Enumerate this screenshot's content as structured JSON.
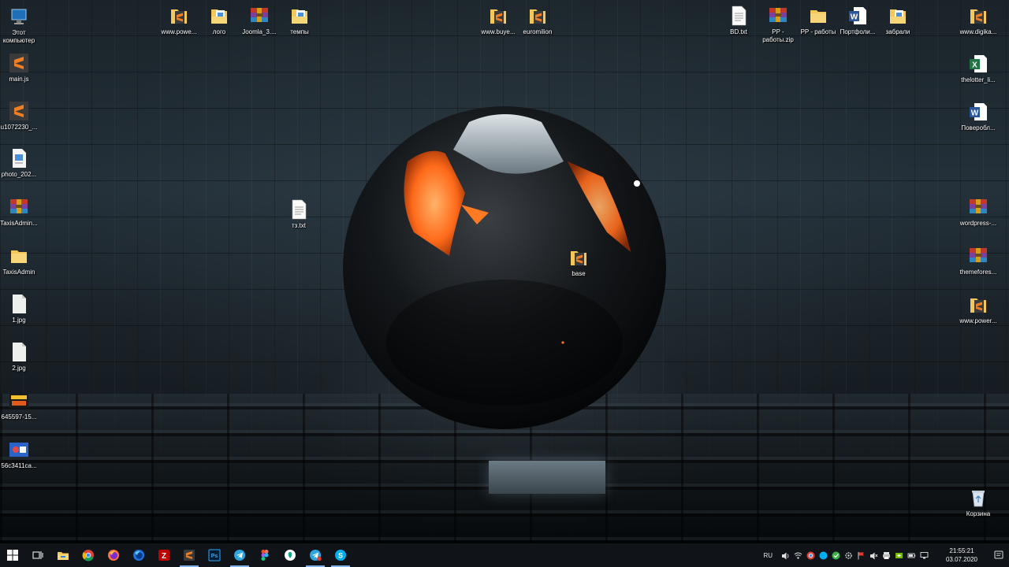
{
  "desktop_icons": [
    {
      "label": "Этот\nкомпьютер",
      "icon": "this-pc-icon",
      "kind": "pc"
    },
    {
      "label": "main.js",
      "icon": "sublime-text-icon",
      "kind": "sublime"
    },
    {
      "label": "u1072230_...",
      "icon": "sublime-text-icon",
      "kind": "sublime"
    },
    {
      "label": "photo_202...",
      "icon": "image-file-icon",
      "kind": "doc"
    },
    {
      "label": "TaxisAdmin...",
      "icon": "winrar-archive-icon",
      "kind": "rar"
    },
    {
      "label": "TaxisAdmin",
      "icon": "folder-icon",
      "kind": "folder"
    },
    {
      "label": "1.jpg",
      "icon": "image-file-icon",
      "kind": "jpg"
    },
    {
      "label": "2.jpg",
      "icon": "image-file-icon",
      "kind": "jpg"
    },
    {
      "label": "645597-15...",
      "icon": "image-thumbnail-icon",
      "kind": "thumb"
    },
    {
      "label": "56c3411ca...",
      "icon": "image-thumbnail-icon",
      "kind": "thumb2"
    },
    {
      "label": "www.powe...",
      "icon": "sublime-folder-icon",
      "kind": "subfolder"
    },
    {
      "label": "лого",
      "icon": "document-folder-icon",
      "kind": "docfolder"
    },
    {
      "label": "Joomla_3....",
      "icon": "winrar-archive-icon",
      "kind": "rar"
    },
    {
      "label": "темпы",
      "icon": "document-folder-icon",
      "kind": "docfolder"
    },
    {
      "label": "тз.txt",
      "icon": "text-file-icon",
      "kind": "txt"
    },
    {
      "label": "www.buye...",
      "icon": "sublime-folder-icon",
      "kind": "subfolder"
    },
    {
      "label": "euromilion",
      "icon": "sublime-folder-icon",
      "kind": "subfolder"
    },
    {
      "label": "base",
      "icon": "sublime-folder-icon",
      "kind": "subfolder"
    },
    {
      "label": "BD.txt",
      "icon": "text-file-icon",
      "kind": "txt"
    },
    {
      "label": "PP -\nработы.zip",
      "icon": "winrar-archive-icon",
      "kind": "rar"
    },
    {
      "label": "PP - работы",
      "icon": "folder-icon",
      "kind": "folder"
    },
    {
      "label": "Портфоли...",
      "icon": "word-document-icon",
      "kind": "word"
    },
    {
      "label": "забрали",
      "icon": "image-folder-icon",
      "kind": "docfolder"
    },
    {
      "label": "www.digika...",
      "icon": "sublime-folder-icon",
      "kind": "subfolder"
    },
    {
      "label": "thelotter_li...",
      "icon": "excel-document-icon",
      "kind": "excel"
    },
    {
      "label": "Поверобл...",
      "icon": "word-document-icon",
      "kind": "word"
    },
    {
      "label": "wordpress-...",
      "icon": "winrar-archive-icon",
      "kind": "rar"
    },
    {
      "label": "themefores...",
      "icon": "winrar-archive-icon",
      "kind": "rar"
    },
    {
      "label": "www.power...",
      "icon": "sublime-folder-icon",
      "kind": "subfolder"
    },
    {
      "label": "Корзина",
      "icon": "recycle-bin-icon",
      "kind": "bin"
    }
  ],
  "taskbar": {
    "buttons": [
      {
        "icon": "windows-start-icon",
        "active": false
      },
      {
        "icon": "task-view-icon",
        "active": false
      },
      {
        "icon": "file-explorer-icon",
        "active": false
      },
      {
        "icon": "chrome-icon",
        "active": false
      },
      {
        "icon": "firefox-icon",
        "active": false
      },
      {
        "icon": "firefox-developer-icon",
        "active": false
      },
      {
        "icon": "filezilla-icon",
        "active": false
      },
      {
        "icon": "sublime-text-icon",
        "active": true
      },
      {
        "icon": "photoshop-icon",
        "active": false
      },
      {
        "icon": "telegram-icon",
        "active": true
      },
      {
        "icon": "figma-icon",
        "active": false
      },
      {
        "icon": "kaspersky-icon",
        "active": false
      },
      {
        "icon": "telegram-notification-icon",
        "active": true
      },
      {
        "icon": "skype-icon",
        "active": true
      }
    ],
    "tray": {
      "language": "RU",
      "icons": [
        "volume-icon",
        "network-icon",
        "chrome-tray-icon",
        "skype-tray-icon",
        "security-check-icon",
        "settings-tray-icon",
        "flag-icon",
        "speaker-muted-icon",
        "printer-icon",
        "nvidia-icon",
        "battery-icon",
        "display-icon"
      ],
      "time": "21:55:21",
      "date": "03.07.2020"
    }
  },
  "colors": {
    "taskbar": "#101418",
    "active_indicator": "#7fb3ea",
    "sublime": "#f07e22",
    "folder": "#f3c75a",
    "winrar_red": "#c0392b",
    "word": "#2b579a",
    "excel": "#217346"
  }
}
